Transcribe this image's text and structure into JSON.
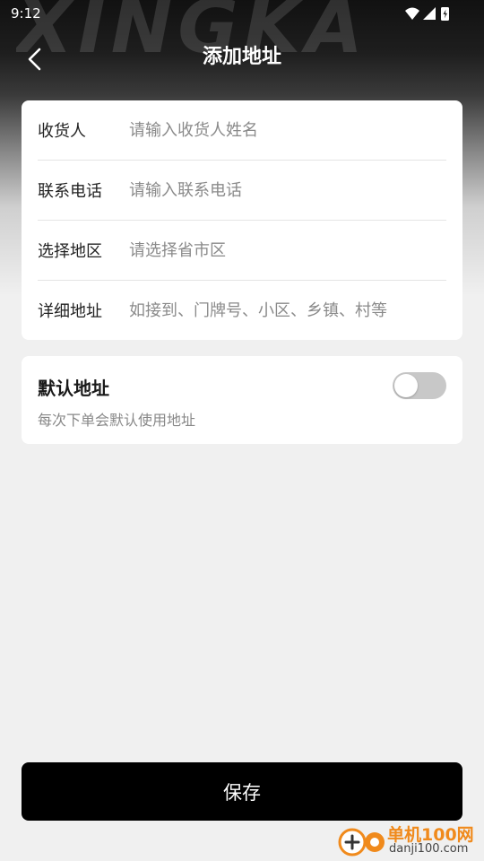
{
  "status_bar": {
    "time": "9:12",
    "icons": [
      "wifi-icon",
      "signal-icon",
      "battery-charging-icon"
    ]
  },
  "brand": {
    "watermark": "XINGKA"
  },
  "nav": {
    "title": "添加地址",
    "back_icon": "chevron-left-icon"
  },
  "form": {
    "rows": [
      {
        "label": "收货人",
        "placeholder": "请输入收货人姓名",
        "value": ""
      },
      {
        "label": "联系电话",
        "placeholder": "请输入联系电话",
        "value": ""
      },
      {
        "label": "选择地区",
        "placeholder": "请选择省市区",
        "value": ""
      },
      {
        "label": "详细地址",
        "placeholder": "如接到、门牌号、小区、乡镇、村等",
        "value": ""
      }
    ]
  },
  "default_address": {
    "title": "默认地址",
    "description": "每次下单会默认使用地址",
    "enabled": false
  },
  "save_button": {
    "label": "保存"
  },
  "site_watermark": {
    "name": "单机100网",
    "url": "danji100.com"
  },
  "colors": {
    "accent": "#000000",
    "background": "#f0f0f0",
    "card": "#ffffff",
    "toggle_off": "#c8c8c8",
    "watermark_orange": "#f08a1c"
  }
}
